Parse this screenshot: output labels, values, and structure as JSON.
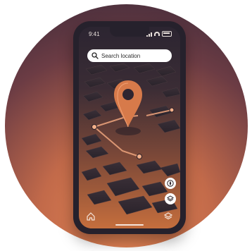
{
  "status_bar": {
    "time": "9:41"
  },
  "search": {
    "placeholder": "Search location"
  },
  "colors": {
    "accent": "#e07a44",
    "map_dark": "#2c2531",
    "map_light": "#c56e3d"
  },
  "icons": {
    "search": "search-icon",
    "pin": "map-pin-icon",
    "compass": "compass-icon",
    "layers": "layers-icon",
    "home": "home-icon"
  }
}
